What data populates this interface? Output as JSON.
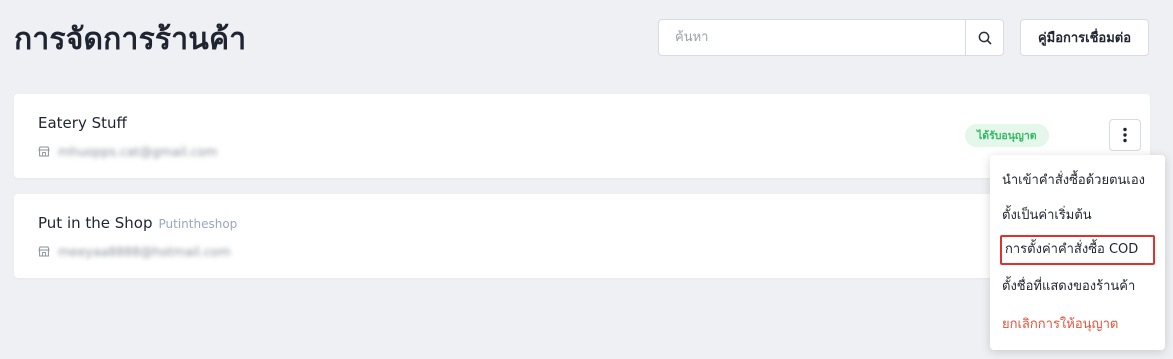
{
  "header": {
    "title": "การจัดการร้านค้า",
    "search_placeholder": "ค้นหา",
    "guide_label": "คู่มือการเชื่อมต่อ"
  },
  "shops": [
    {
      "name": "Eatery Stuff",
      "alias": "",
      "email": "mhuopps.cat@gmail.com",
      "status": "ได้รับอนุญาต"
    },
    {
      "name": "Put in the Shop",
      "alias": "Putintheshop",
      "email": "meeyaa8888@hotmail.com"
    }
  ],
  "menu": {
    "items": [
      "นำเข้าคำสั่งซื้อด้วยตนเอง",
      "ตั้งเป็นค่าเริ่มต้น",
      "การตั้งค่าคำสั่งซื้อ COD",
      "ตั้งชื่อที่แสดงของร้านค้า",
      "ยกเลิกการให้อนุญาต"
    ],
    "highlighted_index": 2
  },
  "colors": {
    "background": "#eef0f4",
    "status_green": "#35b765",
    "danger_red": "#e5523a",
    "highlight_border": "#e03131"
  }
}
